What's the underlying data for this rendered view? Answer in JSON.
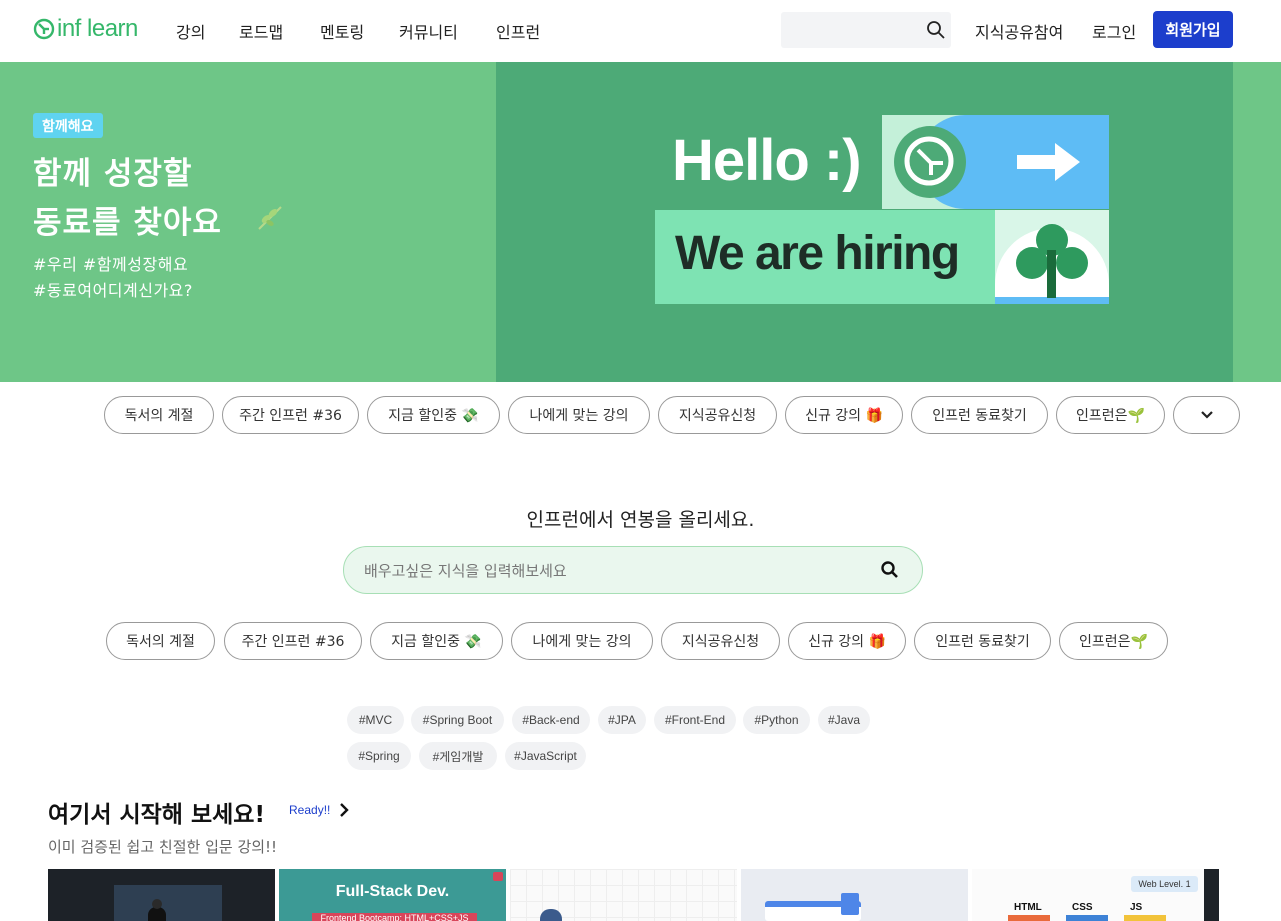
{
  "header": {
    "logo_text": "inf learn",
    "nav": [
      "강의",
      "로드맵",
      "멘토링",
      "커뮤니티",
      "인프런"
    ],
    "search_placeholder": "",
    "share_knowledge": "지식공유참여",
    "login": "로그인",
    "signup": "회원가입"
  },
  "banner": {
    "badge": "함께해요",
    "title_line1": "함께 성장할",
    "title_line2": "동료를 찾아요",
    "tag_line1": "#우리 #함께성장해요",
    "tag_line2": "#동료여어디계신가요?",
    "image_text1": "Hello :)",
    "image_text2": "We are hiring"
  },
  "top_chips": [
    "독서의 계절",
    "주간 인프런 #36",
    "지금 할인중 💸",
    "나에게 맞는 강의",
    "지식공유신청",
    "신규 강의 🎁",
    "인프런 동료찾기",
    "인프런은🌱"
  ],
  "main": {
    "subtitle": "인프런에서 연봉을 올리세요.",
    "search_placeholder": "배우고싶은 지식을 입력해보세요"
  },
  "mid_chips": [
    "독서의 계절",
    "주간 인프런 #36",
    "지금 할인중 💸",
    "나에게 맞는 강의",
    "지식공유신청",
    "신규 강의 🎁",
    "인프런 동료찾기",
    "인프런은🌱"
  ],
  "tags_row1": [
    "#MVC",
    "#Spring Boot",
    "#Back-end",
    "#JPA",
    "#Front-End",
    "#Python",
    "#Java"
  ],
  "tags_row2": [
    "#Spring",
    "#게임개발",
    "#JavaScript"
  ],
  "section": {
    "title": "여기서 시작해 보세요!",
    "ready": "Ready!!",
    "subtitle": "이미 검증된 쉽고 친절한 입문 강의!!"
  },
  "thumbs": {
    "fullstack_title": "Full-Stack Dev.",
    "fullstack_sub": "Frontend Bootcamp: HTML+CSS+JS",
    "web_level": "Web Level. 1",
    "html": "HTML",
    "css": "CSS",
    "js": "JS"
  },
  "colors": {
    "brand_green": "#35b76a",
    "banner_green": "#6ec687",
    "signup_blue": "#1c3ecc"
  }
}
